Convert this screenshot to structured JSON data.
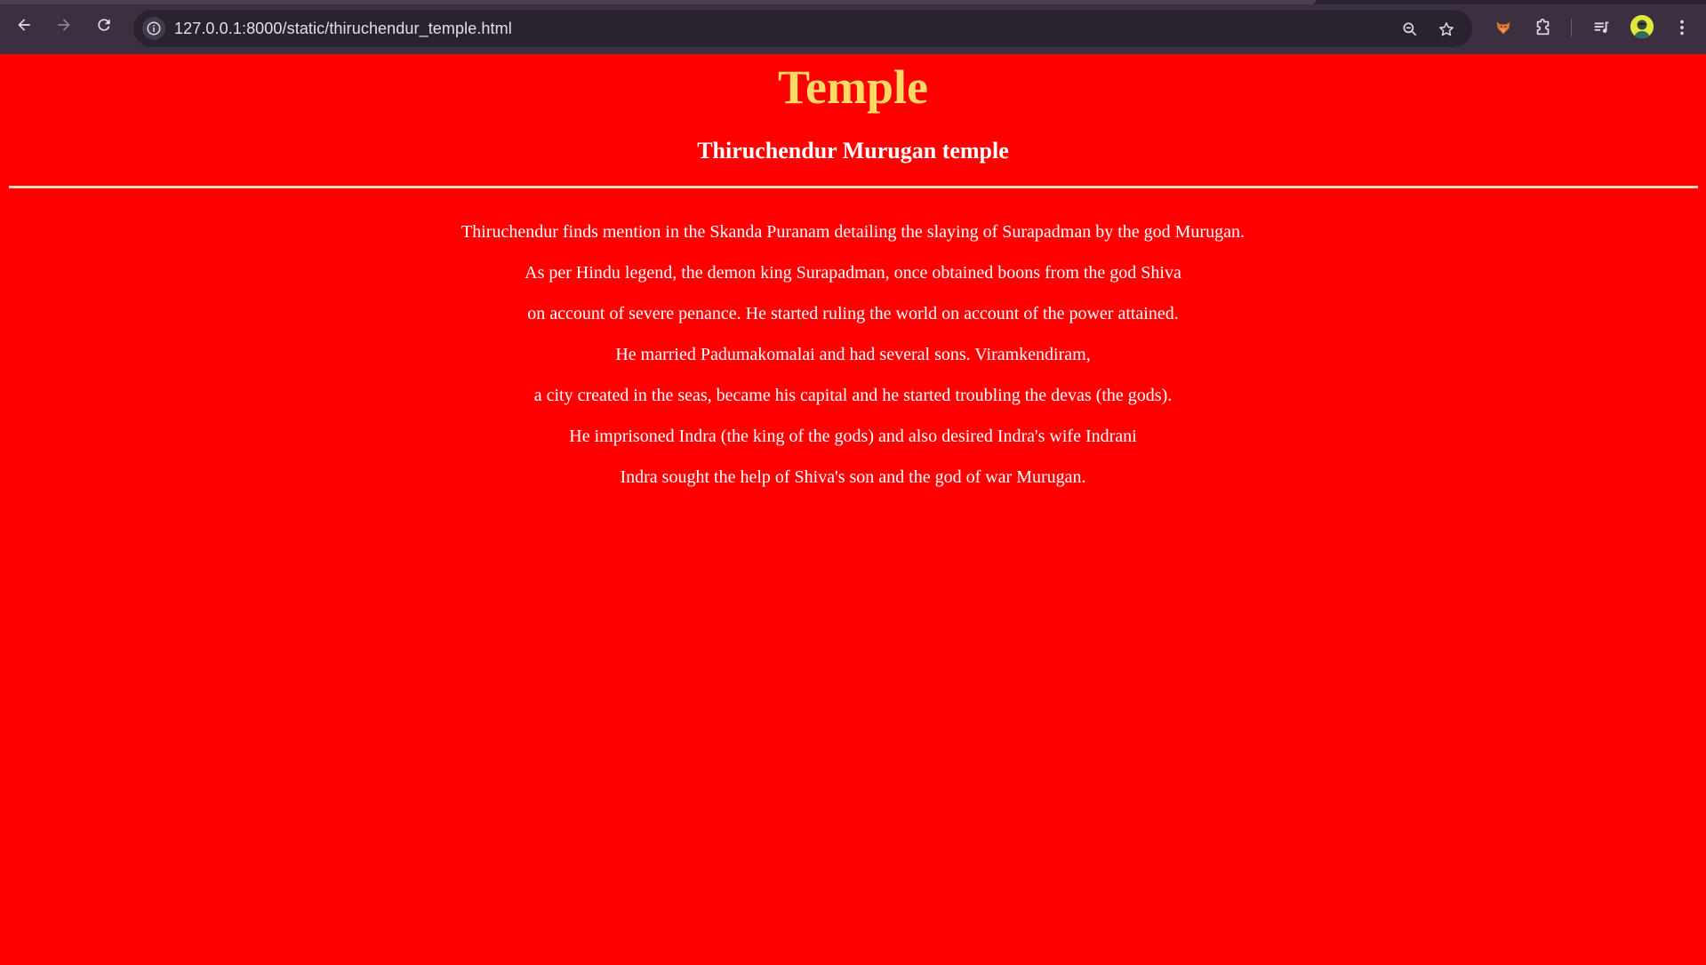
{
  "browser": {
    "url": "127.0.0.1:8000/static/thiruchendur_temple.html",
    "icons": {
      "back": "back-arrow-icon",
      "forward": "forward-arrow-icon",
      "reload": "reload-icon",
      "site_info": "info-icon",
      "zoom": "zoom-out-icon",
      "bookmark": "star-icon",
      "extension_fox": "fox-extension-icon",
      "extensions": "puzzle-icon",
      "media": "media-queue-icon",
      "profile": "avatar",
      "menu": "kebab-menu-icon"
    },
    "colors": {
      "toolbar": "#3c3040",
      "omnibox": "#2b2230"
    }
  },
  "page": {
    "background": "#ff0000",
    "title": "Temple",
    "title_color": "#ffd966",
    "subtitle": "Thiruchendur Murugan temple",
    "lines": [
      "Thiruchendur finds mention in the Skanda Puranam detailing the slaying of Surapadman by the god Murugan.",
      "As per Hindu legend, the demon king Surapadman, once obtained boons from the god Shiva",
      "on account of severe penance. He started ruling the world on account of the power attained.",
      "He married Padumakomalai and had several sons. Viramkendiram,",
      "a city created in the seas, became his capital and he started troubling the devas (the gods).",
      "He imprisoned Indra (the king of the gods) and also desired Indra's wife Indrani",
      "Indra sought the help of Shiva's son and the god of war Murugan."
    ]
  }
}
